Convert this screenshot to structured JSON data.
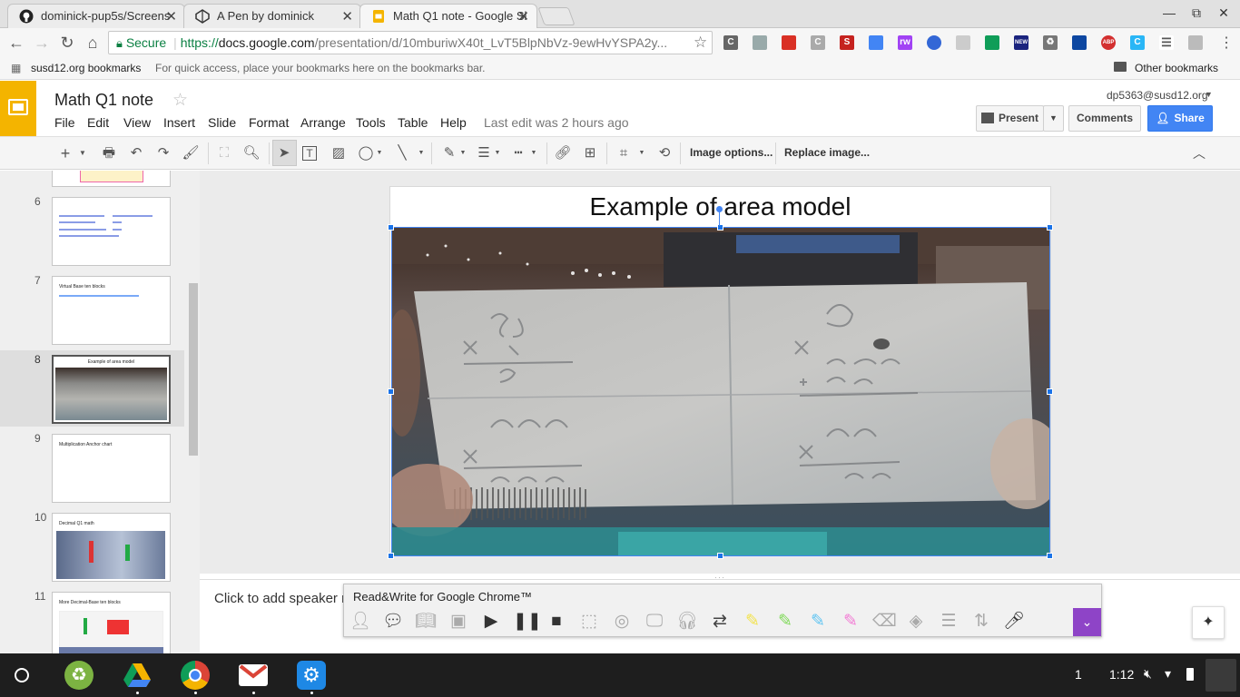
{
  "tabs": [
    {
      "label": "dominick-pup5s/Screens",
      "icon": "github-icon"
    },
    {
      "label": "A Pen by dominick",
      "icon": "codepen-icon"
    },
    {
      "label": "Math Q1 note - Google Sl",
      "icon": "google-slides-icon"
    }
  ],
  "browser": {
    "secure_label": "Secure",
    "url_scheme": "https://",
    "url_host": "docs.google.com",
    "url_path": "/presentation/d/10mburiwX40t_LvT5BlpNbVz-9ewHvYSPA2y..."
  },
  "bookmarks": {
    "folder": "susd12.org bookmarks",
    "hint": "For quick access, place your bookmarks here on the bookmarks bar.",
    "other": "Other bookmarks"
  },
  "doc": {
    "title": "Math Q1 note",
    "account": "dp5363@susd12.org",
    "last_edit": "Last edit was 2 hours ago",
    "menus": [
      "File",
      "Edit",
      "View",
      "Insert",
      "Slide",
      "Format",
      "Arrange",
      "Tools",
      "Table",
      "Help"
    ],
    "present_label": "Present",
    "comments_label": "Comments",
    "share_label": "Share"
  },
  "toolbar": {
    "image_options": "Image options...",
    "replace_image": "Replace image..."
  },
  "slides": [
    {
      "num": "6",
      "title": ""
    },
    {
      "num": "7",
      "title": "Virtual Base ten blocks"
    },
    {
      "num": "8",
      "title": "Example of area model"
    },
    {
      "num": "9",
      "title": "Multiplication Anchor chart"
    },
    {
      "num": "10",
      "title": "Decimal Q1 math"
    },
    {
      "num": "11",
      "title": "More Decimal-Base ten blocks"
    }
  ],
  "current_slide": {
    "title": "Example of area model"
  },
  "notes": {
    "placeholder": "Click to add speaker n"
  },
  "readwrite": {
    "title": "Read&Write for Google Chrome™"
  },
  "shelf": {
    "page": "1",
    "time": "1:12"
  },
  "colors": {
    "accent_blue": "#4285f4",
    "slides_yellow": "#f4b400",
    "rw_purple": "#8e44c7"
  }
}
